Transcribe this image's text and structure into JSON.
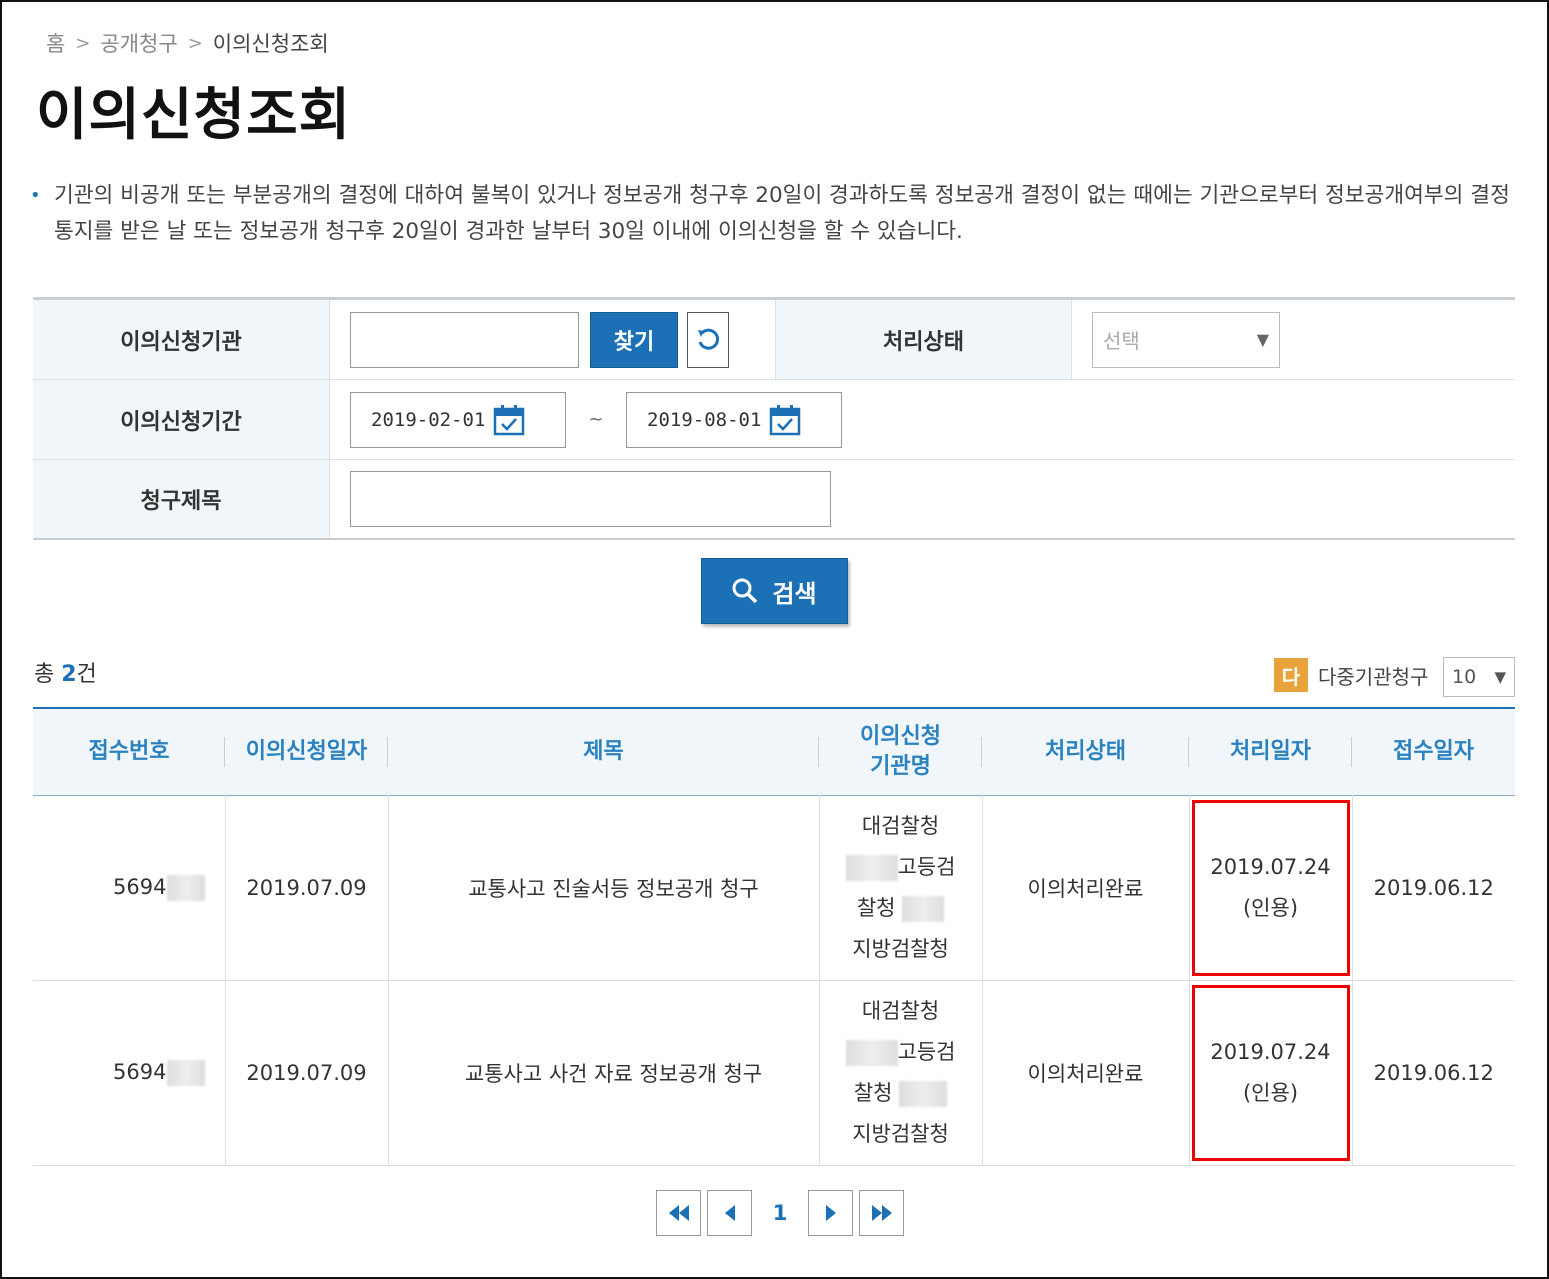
{
  "breadcrumb": {
    "home": "홈",
    "level1": "공개청구",
    "current": "이의신청조회"
  },
  "page_title": "이의신청조회",
  "notice": "기관의 비공개 또는 부분공개의 결정에 대하여 불복이 있거나 정보공개 청구후 20일이 경과하도록 정보공개 결정이 없는 때에는 기관으로부터 정보공개여부의 결정통지를 받은 날 또는 정보공개 청구후 20일이 경과한 날부터 30일 이내에 이의신청을 할 수 있습니다.",
  "form": {
    "org_label": "이의신청기관",
    "org_value": "",
    "find_label": "찾기",
    "status_label": "처리상태",
    "status_select": "선택",
    "period_label": "이의신청기간",
    "date_from": "2019-02-01",
    "date_sep": "~",
    "date_to": "2019-08-01",
    "subject_label": "청구제목",
    "subject_value": ""
  },
  "search_label": "검색",
  "total": {
    "prefix": "총 ",
    "count": "2",
    "suffix": "건"
  },
  "multi": {
    "badge": "다",
    "label": "다중기관청구"
  },
  "page_size": "10",
  "table": {
    "headers": {
      "receipt_no": "접수번호",
      "appeal_date": "이의신청일자",
      "title": "제목",
      "org_line1": "이의신청",
      "org_line2": "기관명",
      "status": "처리상태",
      "process_date": "처리일자",
      "received_date": "접수일자"
    },
    "rows": [
      {
        "receipt_no": "5694",
        "appeal_date": "2019.07.09",
        "title": "교통사고 진술서등 정보공개 청구",
        "org": [
          "대검찰청",
          "고등검",
          "찰청",
          "지방검찰청"
        ],
        "status": "이의처리완료",
        "process_date": "2019.07.24",
        "process_note": "(인용)",
        "received_date": "2019.06.12"
      },
      {
        "receipt_no": "5694",
        "appeal_date": "2019.07.09",
        "title": "교통사고 사건 자료 정보공개 청구",
        "org": [
          "대검찰청",
          "고등검",
          "찰청",
          "지방검찰청"
        ],
        "status": "이의처리완료",
        "process_date": "2019.07.24",
        "process_note": "(인용)",
        "received_date": "2019.06.12"
      }
    ]
  },
  "pager": {
    "current": "1"
  },
  "colors": {
    "primary": "#1c71b6",
    "highlight": "#e00000",
    "badge": "#e8a33a"
  }
}
